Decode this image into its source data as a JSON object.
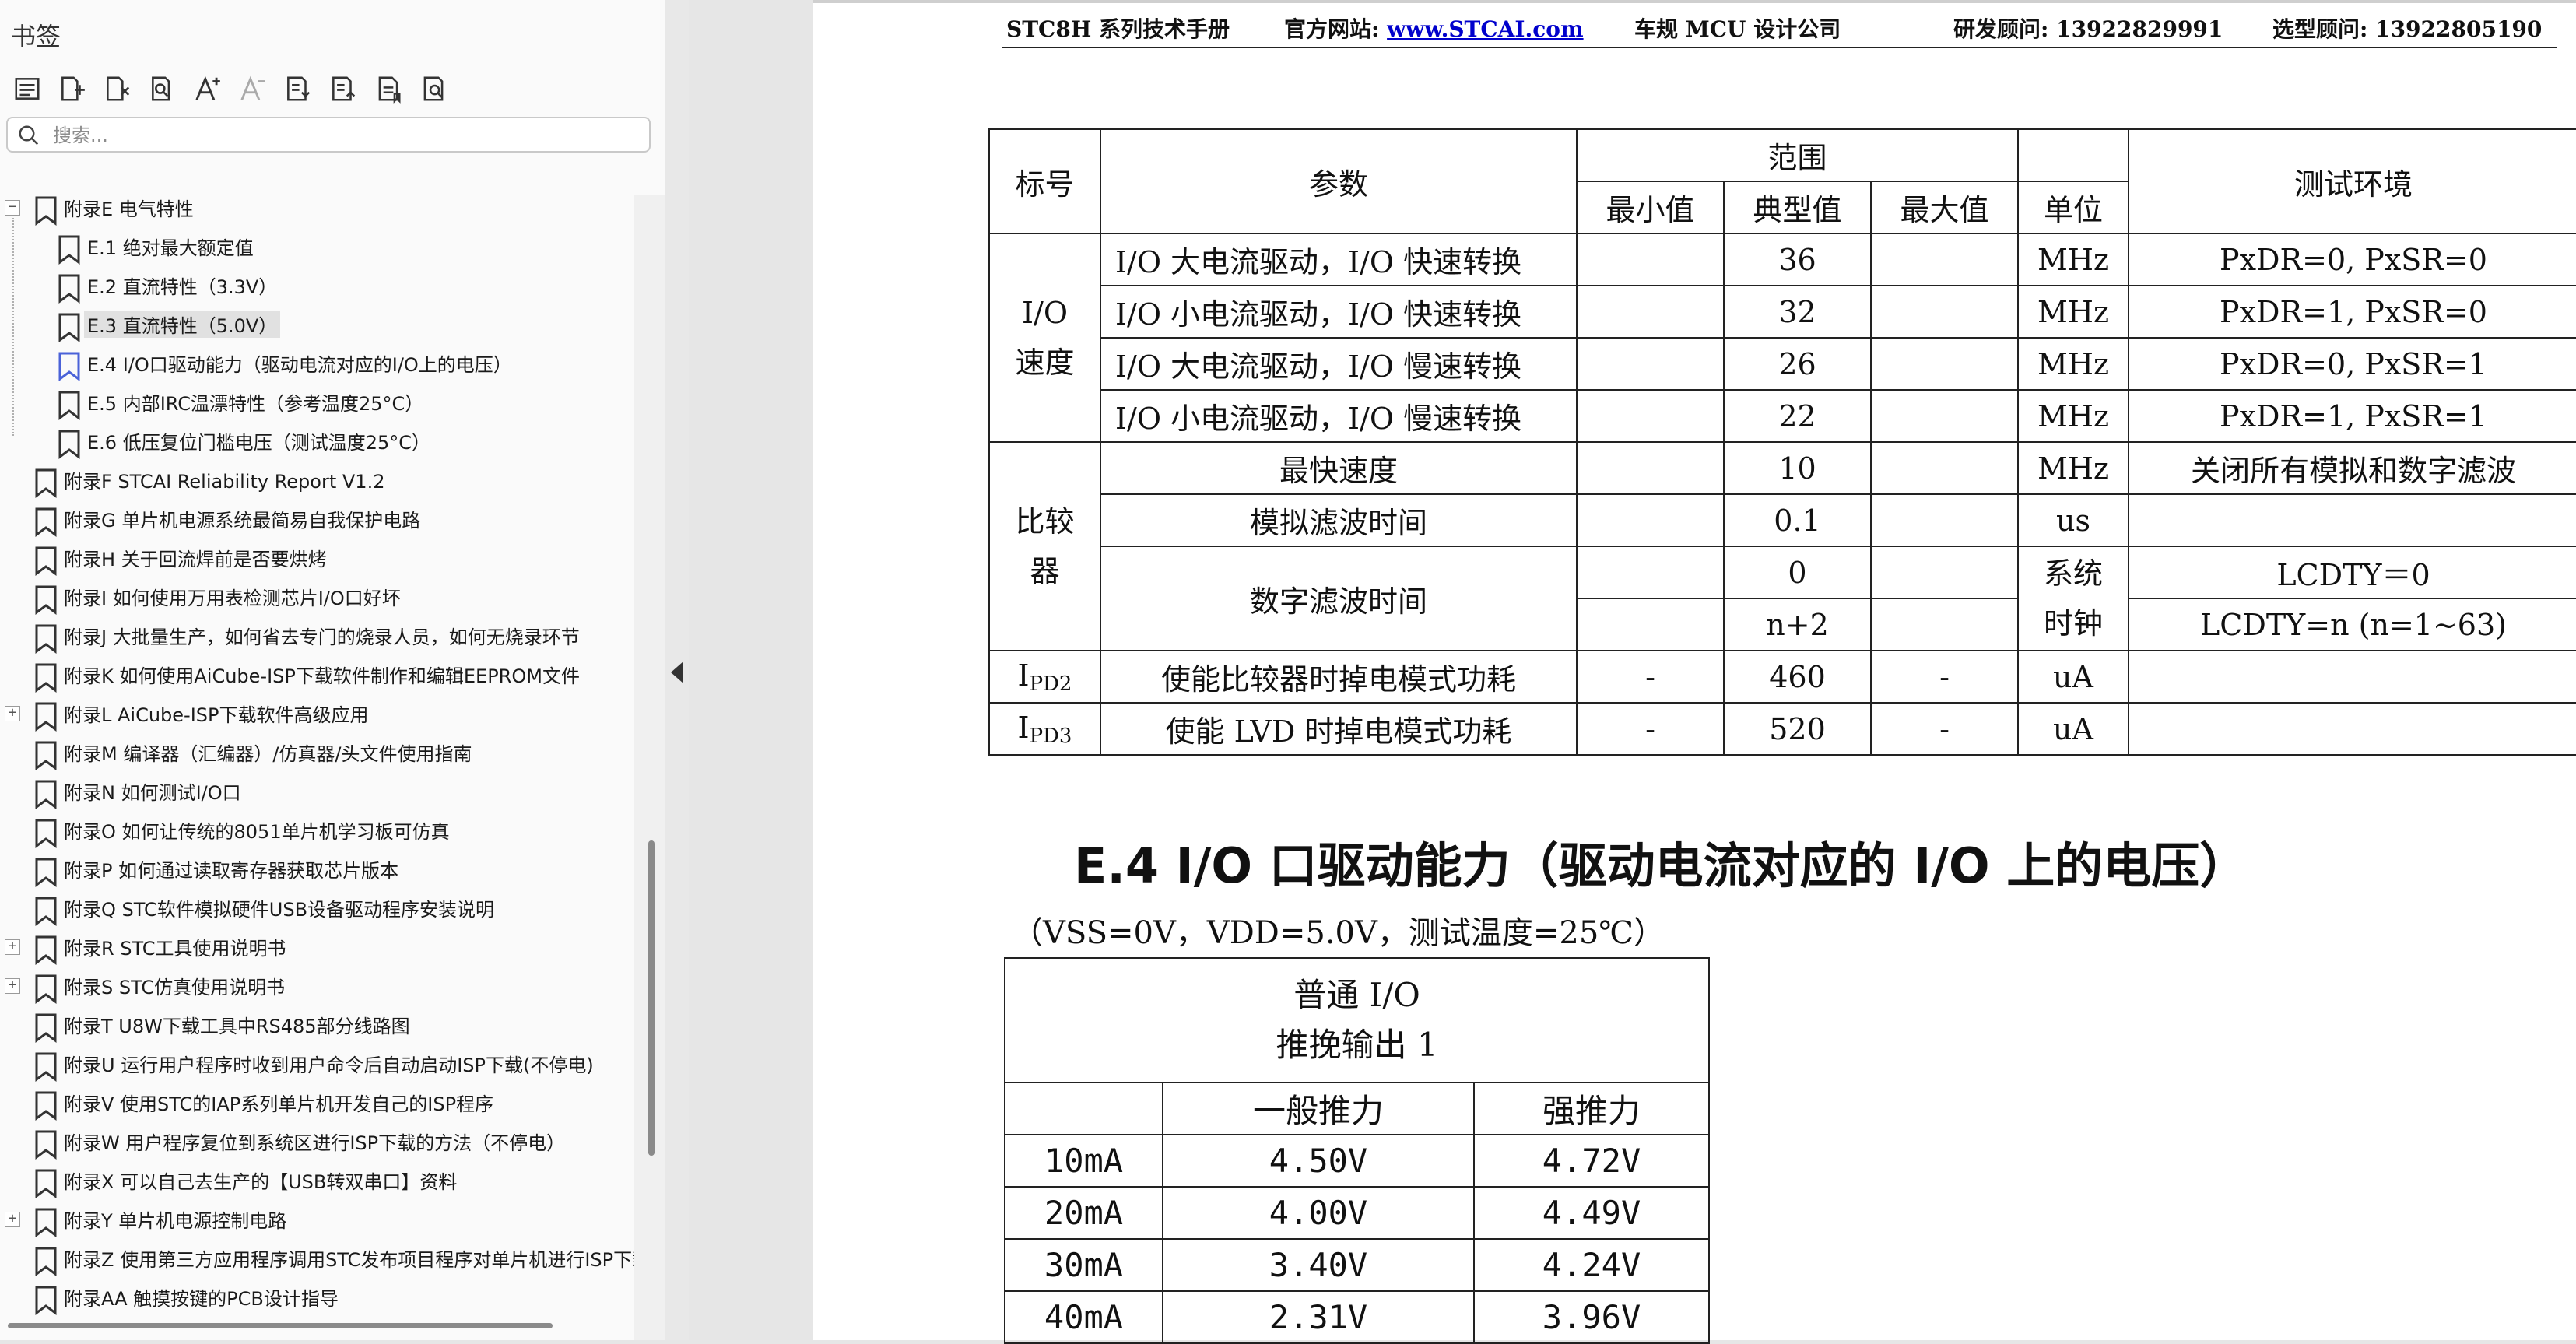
{
  "sidebar": {
    "title": "书签",
    "search_placeholder": "搜索...",
    "toolbar_icons": [
      "bookmark-list-icon",
      "add-bookmark-icon",
      "delete-bookmark-icon",
      "find-bookmark-icon",
      "font-larger-icon",
      "font-smaller-icon",
      "expand-all-icon",
      "collapse-all-icon",
      "page-bookmark-icon",
      "search-bookmark-icon"
    ],
    "items": [
      {
        "label": "附录E  电气特性",
        "level": 0,
        "toggle": "−",
        "selected": false
      },
      {
        "label": "E.1 绝对最大额定值",
        "level": 1,
        "toggle": "",
        "selected": false
      },
      {
        "label": "E.2  直流特性（3.3V）",
        "level": 1,
        "toggle": "",
        "selected": false
      },
      {
        "label": "E.3  直流特性（5.0V）",
        "level": 1,
        "toggle": "",
        "selected": true
      },
      {
        "label": "E.4 I/O口驱动能力（驱动电流对应的I/O上的电压）",
        "level": 1,
        "toggle": "",
        "selected": false,
        "current": true
      },
      {
        "label": "E.5 内部IRC温漂特性（参考温度25°C）",
        "level": 1,
        "toggle": "",
        "selected": false
      },
      {
        "label": "E.6 低压复位门槛电压（测试温度25°C）",
        "level": 1,
        "toggle": "",
        "selected": false
      },
      {
        "label": "附录F  STCAI Reliability Report V1.2",
        "level": 0,
        "toggle": "",
        "selected": false
      },
      {
        "label": "附录G  单片机电源系统最简易自我保护电路",
        "level": 0,
        "toggle": "",
        "selected": false
      },
      {
        "label": "附录H  关于回流焊前是否要烘烤",
        "level": 0,
        "toggle": "",
        "selected": false
      },
      {
        "label": "附录I  如何使用万用表检测芯片I/O口好坏",
        "level": 0,
        "toggle": "",
        "selected": false
      },
      {
        "label": "附录J  大批量生产，如何省去专门的烧录人员，如何无烧录环节",
        "level": 0,
        "toggle": "",
        "selected": false
      },
      {
        "label": "附录K  如何使用AiCube-ISP下载软件制作和编辑EEPROM文件",
        "level": 0,
        "toggle": "",
        "selected": false
      },
      {
        "label": "附录L  AiCube-ISP下载软件高级应用",
        "level": 0,
        "toggle": "+",
        "selected": false
      },
      {
        "label": "附录M  编译器（汇编器）/仿真器/头文件使用指南",
        "level": 0,
        "toggle": "",
        "selected": false
      },
      {
        "label": "附录N  如何测试I/O口",
        "level": 0,
        "toggle": "",
        "selected": false
      },
      {
        "label": "附录O  如何让传统的8051单片机学习板可仿真",
        "level": 0,
        "toggle": "",
        "selected": false
      },
      {
        "label": "附录P  如何通过读取寄存器获取芯片版本",
        "level": 0,
        "toggle": "",
        "selected": false
      },
      {
        "label": "附录Q  STC软件模拟硬件USB设备驱动程序安装说明",
        "level": 0,
        "toggle": "",
        "selected": false
      },
      {
        "label": "附录R  STC工具使用说明书",
        "level": 0,
        "toggle": "+",
        "selected": false
      },
      {
        "label": "附录S  STC仿真使用说明书",
        "level": 0,
        "toggle": "+",
        "selected": false
      },
      {
        "label": "附录T  U8W下载工具中RS485部分线路图",
        "level": 0,
        "toggle": "",
        "selected": false
      },
      {
        "label": "附录U  运行用户程序时收到用户命令后自动启动ISP下载(不停电)",
        "level": 0,
        "toggle": "",
        "selected": false
      },
      {
        "label": "附录V  使用STC的IAP系列单片机开发自己的ISP程序",
        "level": 0,
        "toggle": "",
        "selected": false
      },
      {
        "label": "附录W  用户程序复位到系统区进行ISP下载的方法（不停电）",
        "level": 0,
        "toggle": "",
        "selected": false
      },
      {
        "label": "附录X  可以自己去生产的【USB转双串口】资料",
        "level": 0,
        "toggle": "",
        "selected": false
      },
      {
        "label": "附录Y  单片机电源控制电路",
        "level": 0,
        "toggle": "+",
        "selected": false
      },
      {
        "label": "附录Z  使用第三方应用程序调用STC发布项目程序对单片机进行ISP下载",
        "level": 0,
        "toggle": "",
        "selected": false
      },
      {
        "label": "附录AA  触摸按键的PCB设计指导",
        "level": 0,
        "toggle": "",
        "selected": false
      }
    ]
  },
  "page": {
    "header": {
      "manual": "STC8H 系列技术手册",
      "website_label": "官方网站:",
      "website_link": "www.STCAI.com",
      "company": "车规 MCU 设计公司",
      "rd_contact": "研发顾问: 13922829991",
      "sales_contact": "选型顾问: 13922805190"
    },
    "spec_table": {
      "col_symbol": "标号",
      "col_param": "参数",
      "col_range": "范围",
      "col_min": "最小值",
      "col_typ": "典型值",
      "col_max": "最大值",
      "col_unit": "单位",
      "col_env": "测试环境",
      "io_speed_label": "I/O\n速度",
      "io_rows": [
        {
          "param": "I/O 大电流驱动，I/O 快速转换",
          "min": "",
          "typ": "36",
          "max": "",
          "unit": "MHz",
          "env": "PxDR=0, PxSR=0"
        },
        {
          "param": "I/O 小电流驱动，I/O 快速转换",
          "min": "",
          "typ": "32",
          "max": "",
          "unit": "MHz",
          "env": "PxDR=1, PxSR=0"
        },
        {
          "param": "I/O 大电流驱动，I/O 慢速转换",
          "min": "",
          "typ": "26",
          "max": "",
          "unit": "MHz",
          "env": "PxDR=0, PxSR=1"
        },
        {
          "param": "I/O 小电流驱动，I/O 慢速转换",
          "min": "",
          "typ": "22",
          "max": "",
          "unit": "MHz",
          "env": "PxDR=1, PxSR=1"
        }
      ],
      "comp_label": "比较\n器",
      "comp_fast": {
        "param": "最快速度",
        "typ": "10",
        "unit": "MHz",
        "env": "关闭所有模拟和数字滤波"
      },
      "comp_analog": {
        "param": "模拟滤波时间",
        "typ": "0.1",
        "unit": "us",
        "env": ""
      },
      "comp_digital": {
        "param": "数字滤波时间",
        "typ1": "0",
        "typ2": "n+2",
        "unit": "系统\n时钟",
        "env1": "LCDTY＝0",
        "env2": "LCDTY=n (n=1~63)"
      },
      "ipd2": {
        "sym": "I",
        "sub": "PD2",
        "param": "使能比较器时掉电模式功耗",
        "min": "-",
        "typ": "460",
        "max": "-",
        "unit": "uA",
        "env": ""
      },
      "ipd3": {
        "sym": "I",
        "sub": "PD3",
        "param": "使能 LVD 时掉电模式功耗",
        "min": "-",
        "typ": "520",
        "max": "-",
        "unit": "uA",
        "env": ""
      }
    },
    "section_title": "E.4    I/O 口驱动能力（驱动电流对应的 I/O 上的电压）",
    "conditions": "（VSS=0V，VDD=5.0V，测试温度=25℃）",
    "io_table": {
      "title_line1": "普通 I/O",
      "title_line2": "推挽输出 1",
      "col_normal": "一般推力",
      "col_strong": "强推力",
      "rows": [
        {
          "current": "10mA",
          "normal": "4.50V",
          "strong": "4.72V"
        },
        {
          "current": "20mA",
          "normal": "4.00V",
          "strong": "4.49V"
        },
        {
          "current": "30mA",
          "normal": "3.40V",
          "strong": "4.24V"
        },
        {
          "current": "40mA",
          "normal": "2.31V",
          "strong": "3.96V"
        }
      ]
    }
  }
}
